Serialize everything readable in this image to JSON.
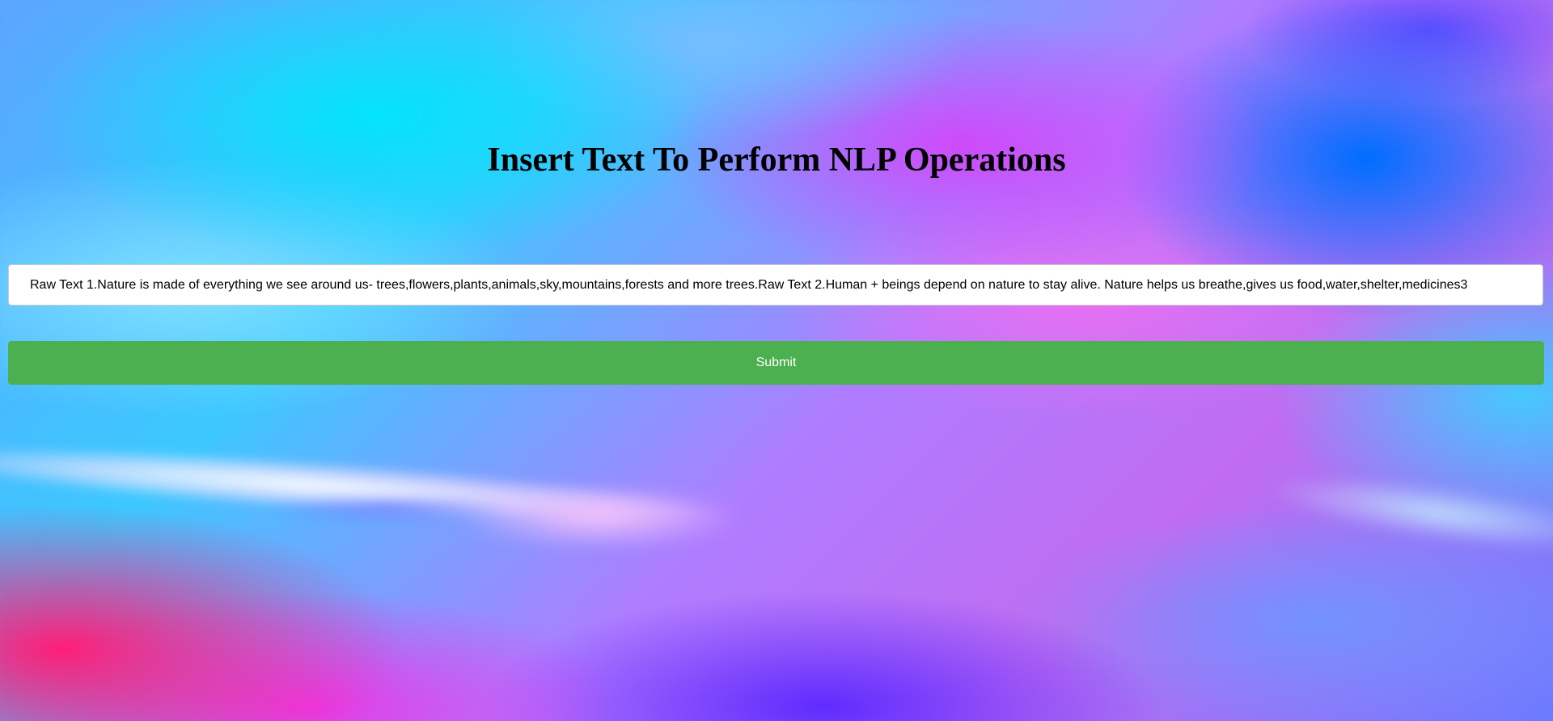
{
  "page": {
    "title": "Insert Text To Perform NLP Operations"
  },
  "form": {
    "text_input_value": "Raw Text 1.Nature is made of everything we see around us- trees,flowers,plants,animals,sky,mountains,forests and more trees.Raw Text 2.Human + beings depend on nature to stay alive. Nature helps us breathe,gives us food,water,shelter,medicines3",
    "submit_label": "Submit",
    "submit_color": "#4caf50"
  },
  "theme": {
    "background": "multicolor gradient (cyan, blue, magenta, pink)"
  }
}
